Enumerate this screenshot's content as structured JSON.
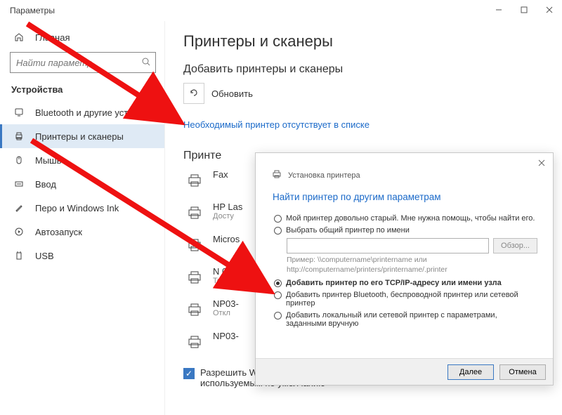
{
  "window_title": "Параметры",
  "sidebar": {
    "home": "Главная",
    "search_placeholder": "Найти параметр",
    "section": "Устройства",
    "items": [
      {
        "label": "Bluetooth и другие устройства"
      },
      {
        "label": "Принтеры и сканеры"
      },
      {
        "label": "Мышь"
      },
      {
        "label": "Ввод"
      },
      {
        "label": "Перо и Windows Ink"
      },
      {
        "label": "Автозапуск"
      },
      {
        "label": "USB"
      }
    ]
  },
  "main": {
    "h1": "Принтеры и сканеры",
    "h2_add": "Добавить принтеры и сканеры",
    "refresh": "Обновить",
    "missing_link": "Необходимый принтер отсутствует в списке",
    "h2_list": "Принте",
    "printers": [
      {
        "name": "Fax",
        "status": ""
      },
      {
        "name": "HP Las",
        "status": "Досту"
      },
      {
        "name": "Micros",
        "status": ""
      },
      {
        "name": "N 03-",
        "status": "Тоне"
      },
      {
        "name": "NP03-",
        "status": "Откл"
      },
      {
        "name": "NP03-",
        "status": ""
      }
    ],
    "manage_checkbox": "Разрешить Windows управлять принтером, используемым по умолчанию"
  },
  "dialog": {
    "header": "Установка принтера",
    "title": "Найти принтер по другим параметрам",
    "r_old": "Мой принтер довольно старый. Мне нужна помощь, чтобы найти его.",
    "r_shared": "Выбрать общий принтер по имени",
    "browse": "Обзор...",
    "example1": "Пример: \\\\computername\\printername или",
    "example2": "http://computername/printers/printername/.printer",
    "r_tcpip": "Добавить принтер по его TCP/IP-адресу или имени узла",
    "r_bluetooth": "Добавить принтер Bluetooth, беспроводной принтер или сетевой принтер",
    "r_local": "Добавить локальный или сетевой принтер с параметрами, заданными вручную",
    "btn_next": "Далее",
    "btn_cancel": "Отмена"
  }
}
